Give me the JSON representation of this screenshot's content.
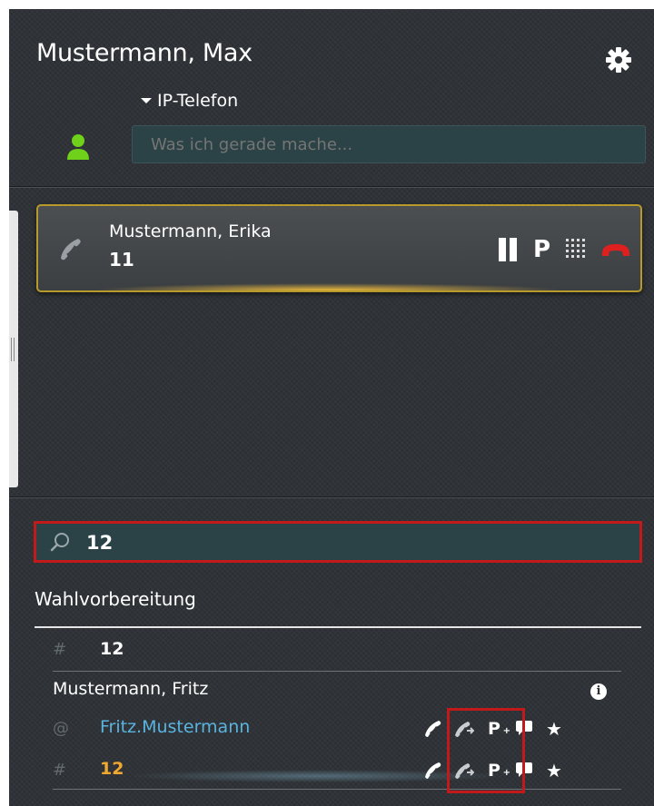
{
  "header": {
    "user_name": "Mustermann, Max",
    "device": "IP-Telefon",
    "status_placeholder": "Was ich gerade mache..."
  },
  "active_call": {
    "caller_name": "Mustermann, Erika",
    "caller_number": "11",
    "park_label": "P"
  },
  "search": {
    "value": "12"
  },
  "results": {
    "section_title": "Wahlvorbereitung",
    "dial_entry": {
      "symbol": "#",
      "number": "12"
    },
    "contact": {
      "name": "Mustermann, Fritz",
      "info_label": "i",
      "email_symbol": "@",
      "email": "Fritz.Mustermann",
      "number_symbol": "#",
      "number": "12"
    },
    "park_action_label": "P"
  },
  "colors": {
    "presence_available": "#6fd11a",
    "hangup_red": "#e01f1f",
    "highlight_red": "#c21a1a",
    "email_blue": "#5ab4e0",
    "number_orange": "#f0a830",
    "call_border_gold": "#b89a2b"
  },
  "icons": [
    "gear-icon",
    "caret-down-icon",
    "person-icon",
    "phone-icon",
    "pause-icon",
    "keypad-icon",
    "hangup-icon",
    "search-icon",
    "info-icon",
    "call-icon",
    "forward-icon",
    "park-icon",
    "chat-icon",
    "star-icon"
  ]
}
